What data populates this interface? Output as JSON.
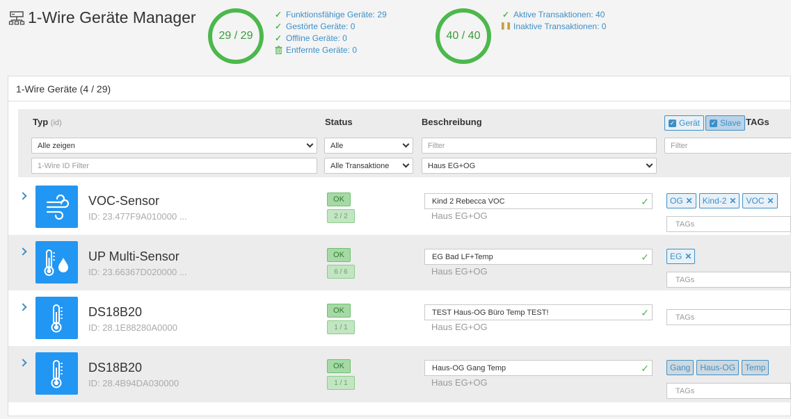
{
  "app": {
    "title": "1-Wire Geräte Manager",
    "icon": "network-icon"
  },
  "summary_devices": {
    "ring_text": "29 / 29",
    "items": [
      {
        "icon": "check-icon",
        "label": "Funktionsfähige Geräte: 29"
      },
      {
        "icon": "check-icon",
        "label": "Gestörte Geräte: 0"
      },
      {
        "icon": "check-icon",
        "label": "Offline Geräte: 0"
      },
      {
        "icon": "trash-icon",
        "label": "Entfernte Geräte: 0"
      }
    ]
  },
  "summary_transactions": {
    "ring_text": "40 / 40",
    "items": [
      {
        "icon": "check-icon",
        "label": "Aktive Transaktionen: 40"
      },
      {
        "icon": "pause-icon",
        "label": "Inaktive Transaktionen: 0"
      }
    ]
  },
  "panel": {
    "heading": "1-Wire Geräte (4 / 29)"
  },
  "filters": {
    "col_type": "Typ",
    "col_type_sub": "(id)",
    "col_status": "Status",
    "col_description": "Beschreibung",
    "col_tags": "TAGs",
    "type_select": "Alle zeigen",
    "id_filter_placeholder": "1-Wire ID Filter",
    "status_select": "Alle",
    "transaction_select": "Alle Transaktione",
    "description_filter_placeholder": "Filter",
    "location_select": "Haus EG+OG",
    "tags_filter_placeholder": "Filter",
    "toggle_device": "Gerät",
    "toggle_slave": "Slave"
  },
  "devices": [
    {
      "icon": "wind-icon",
      "name": "VOC-Sensor",
      "id": "ID: 23.477F9A010000 ...",
      "status": "OK",
      "count": "2 / 2",
      "description": "Kind 2 Rebecca VOC",
      "location": "Haus EG+OG",
      "tags": [
        "OG",
        "Kind-2",
        "VOC"
      ],
      "tags_placeholder": "TAGs"
    },
    {
      "icon": "thermometer-drop-icon",
      "name": "UP Multi-Sensor",
      "id": "ID: 23.66367D020000 ...",
      "status": "OK",
      "count": "6 / 6",
      "description": "EG Bad LF+Temp",
      "location": "Haus EG+OG",
      "tags": [
        "EG"
      ],
      "tags_placeholder": "TAGs"
    },
    {
      "icon": "thermometer-icon",
      "name": "DS18B20",
      "id": "ID: 28.1E88280A0000",
      "status": "OK",
      "count": "1 / 1",
      "description": "TEST Haus-OG Büro Temp TEST!",
      "location": "Haus EG+OG",
      "tags": [],
      "tags_placeholder": "TAGs"
    },
    {
      "icon": "thermometer-icon",
      "name": "DS18B20",
      "id": "ID: 28.4B94DA030000",
      "status": "OK",
      "count": "1 / 1",
      "description": "Haus-OG Gang Temp",
      "location": "Haus EG+OG",
      "tags": [
        "Gang",
        "Haus-OG",
        "Temp"
      ],
      "tags_placeholder": "TAGs"
    }
  ]
}
